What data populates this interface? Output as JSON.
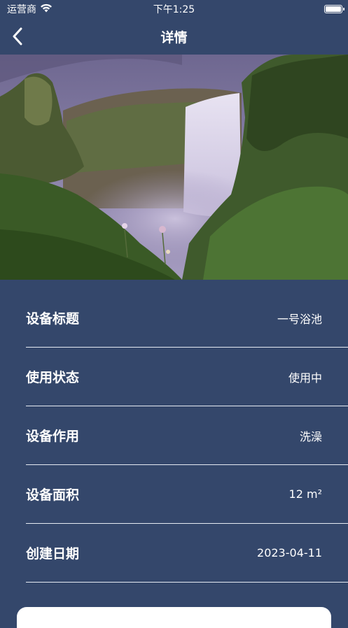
{
  "status_bar": {
    "carrier": "运营商",
    "time": "下午1:25"
  },
  "nav": {
    "title": "详情",
    "back_icon": "chevron-left-icon"
  },
  "hero_image": {
    "description_icon": "waterfall-photo"
  },
  "details": [
    {
      "label": "设备标题",
      "value": "一号浴池"
    },
    {
      "label": "使用状态",
      "value": "使用中"
    },
    {
      "label": "设备作用",
      "value": "洗澡"
    },
    {
      "label": "设备面积",
      "value": "12 m²"
    },
    {
      "label": "创建日期",
      "value": "2023-04-11"
    }
  ],
  "colors": {
    "background": "#34476b",
    "divider": "#e6ebf3",
    "text": "#ffffff"
  }
}
